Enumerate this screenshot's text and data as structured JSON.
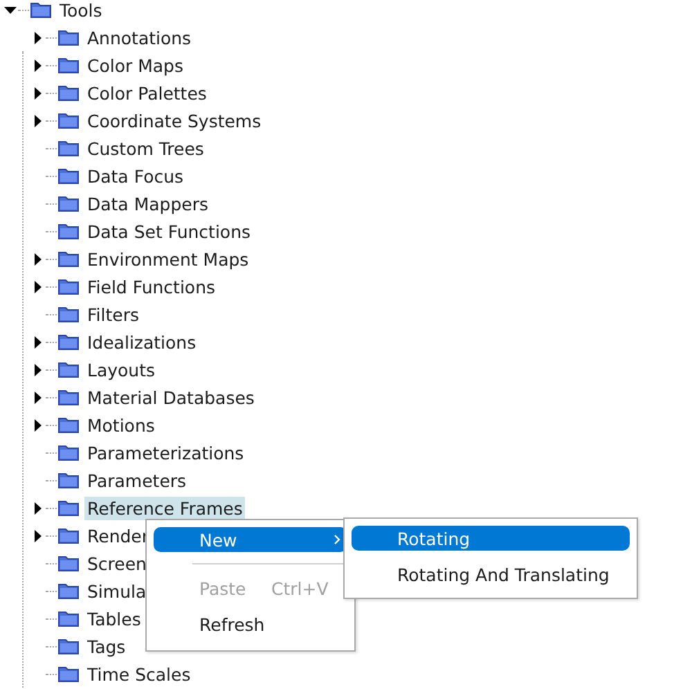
{
  "tree": [
    {
      "label": "Tools",
      "expanded": true,
      "has_children": true,
      "selected": false,
      "children": [
        {
          "label": "Annotations",
          "expanded": false,
          "has_children": true,
          "selected": false
        },
        {
          "label": "Color Maps",
          "expanded": false,
          "has_children": true,
          "selected": false
        },
        {
          "label": "Color Palettes",
          "expanded": false,
          "has_children": true,
          "selected": false
        },
        {
          "label": "Coordinate Systems",
          "expanded": false,
          "has_children": true,
          "selected": false
        },
        {
          "label": "Custom Trees",
          "has_children": false,
          "selected": false
        },
        {
          "label": "Data Focus",
          "has_children": false,
          "selected": false
        },
        {
          "label": "Data Mappers",
          "has_children": false,
          "selected": false
        },
        {
          "label": "Data Set Functions",
          "has_children": false,
          "selected": false
        },
        {
          "label": "Environment Maps",
          "expanded": false,
          "has_children": true,
          "selected": false
        },
        {
          "label": "Field Functions",
          "expanded": false,
          "has_children": true,
          "selected": false
        },
        {
          "label": "Filters",
          "has_children": false,
          "selected": false
        },
        {
          "label": "Idealizations",
          "expanded": false,
          "has_children": true,
          "selected": false
        },
        {
          "label": "Layouts",
          "expanded": false,
          "has_children": true,
          "selected": false
        },
        {
          "label": "Material Databases",
          "expanded": false,
          "has_children": true,
          "selected": false
        },
        {
          "label": "Motions",
          "expanded": false,
          "has_children": true,
          "selected": false
        },
        {
          "label": "Parameterizations",
          "has_children": false,
          "selected": false
        },
        {
          "label": "Parameters",
          "has_children": false,
          "selected": false
        },
        {
          "label": "Reference Frames",
          "expanded": false,
          "has_children": true,
          "selected": true
        },
        {
          "label": "Render",
          "expanded": false,
          "has_children": true,
          "selected": false
        },
        {
          "label": "Screen",
          "has_children": false,
          "selected": false
        },
        {
          "label": "Simula",
          "has_children": false,
          "selected": false
        },
        {
          "label": "Tables",
          "has_children": false,
          "selected": false
        },
        {
          "label": "Tags",
          "has_children": false,
          "selected": false
        },
        {
          "label": "Time Scales",
          "has_children": false,
          "selected": false
        }
      ]
    }
  ],
  "context_menu": {
    "items": [
      {
        "kind": "item",
        "label": "New",
        "submenu": true,
        "selected": true,
        "disabled": false
      },
      {
        "kind": "separator"
      },
      {
        "kind": "item",
        "label": "Paste",
        "shortcut": "Ctrl+V",
        "selected": false,
        "disabled": true
      },
      {
        "kind": "item",
        "label": "Refresh",
        "selected": false,
        "disabled": false
      }
    ]
  },
  "submenu": {
    "items": [
      {
        "label": "Rotating",
        "selected": true
      },
      {
        "label": "Rotating And Translating",
        "selected": false
      }
    ]
  }
}
